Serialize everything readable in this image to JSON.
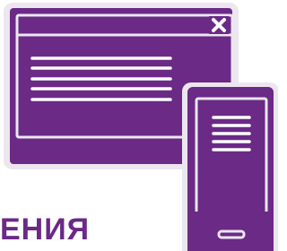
{
  "illustration": {
    "desktop_window": {
      "close_glyph": "close-icon",
      "text_lines": 5
    },
    "phone": {
      "text_lines": 5
    }
  },
  "caption": {
    "text": "ЕНИЯ"
  },
  "colors": {
    "background": "#ffffff",
    "accent": "#6a2a86",
    "frame": "#ece6ef",
    "line": "#ffffff"
  }
}
